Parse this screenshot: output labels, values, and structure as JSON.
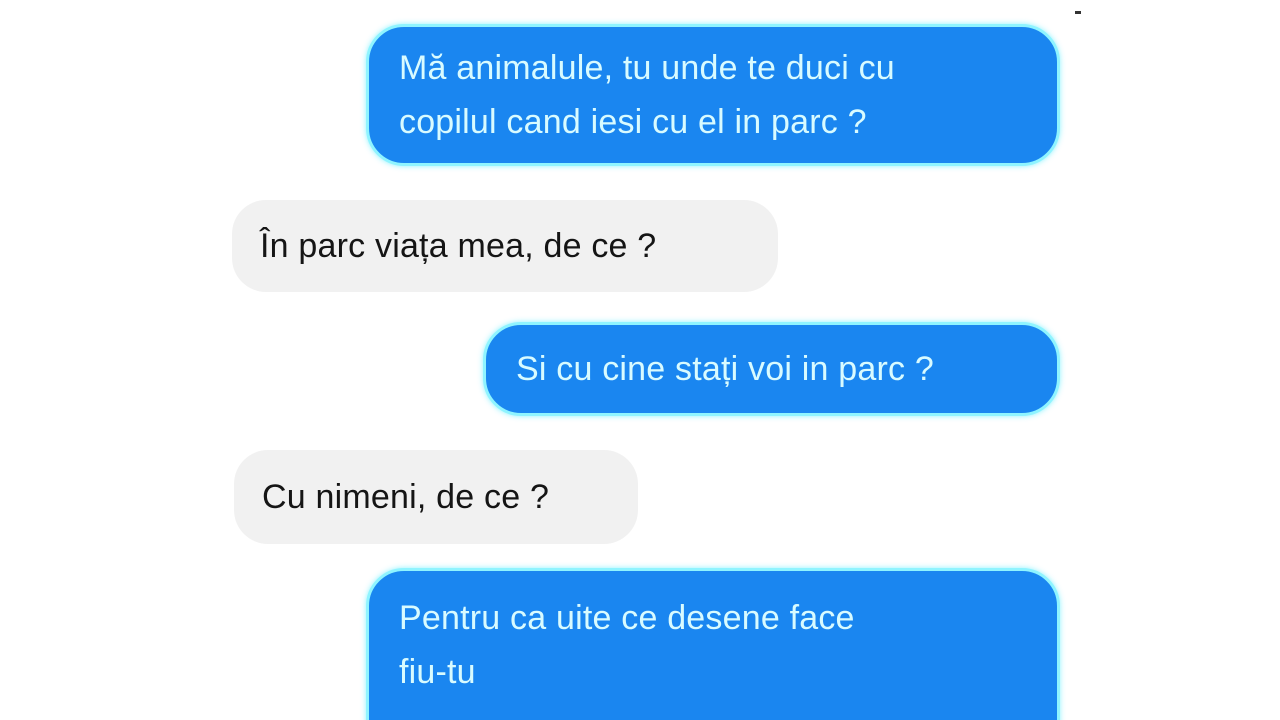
{
  "colors": {
    "sent_bubble": "#1a86f0",
    "sent_text": "#d8fbff",
    "sent_glow": "#8ff4ff",
    "received_bubble": "#f1f1f1",
    "received_text": "#151515"
  },
  "messages": [
    {
      "direction": "sent",
      "text": "Mă animalule, tu unde te duci cu\ncopilul cand iesi cu el in parc ?"
    },
    {
      "direction": "received",
      "text": "În parc viața mea, de ce  ?"
    },
    {
      "direction": "sent",
      "text": "Si cu cine stați voi in parc ?"
    },
    {
      "direction": "received",
      "text": "Cu nimeni, de ce  ?"
    },
    {
      "direction": "sent",
      "text": "Pentru ca uite ce desene face\nfiu-tu"
    }
  ]
}
